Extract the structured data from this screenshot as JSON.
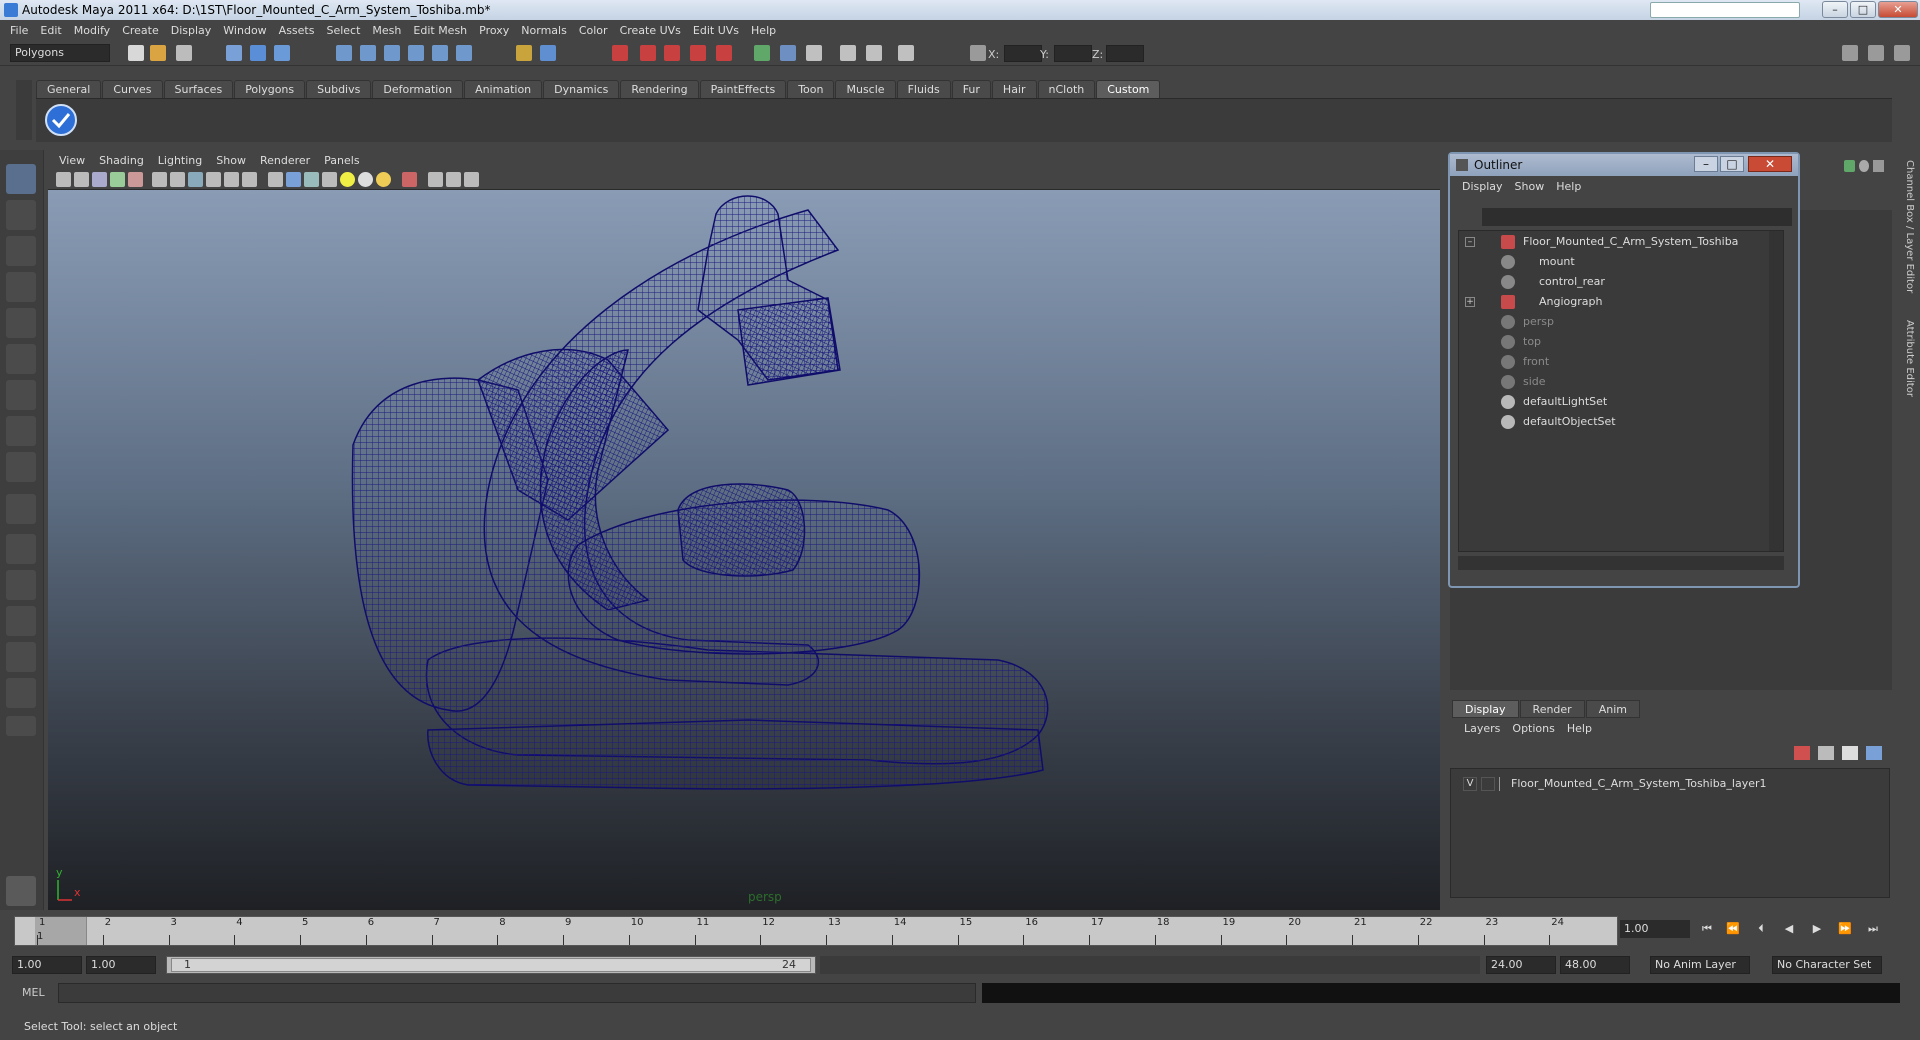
{
  "window": {
    "title": "Autodesk Maya 2011 x64: D:\\1ST\\Floor_Mounted_C_Arm_System_Toshiba.mb*"
  },
  "menubar": [
    "File",
    "Edit",
    "Modify",
    "Create",
    "Display",
    "Window",
    "Assets",
    "Select",
    "Mesh",
    "Edit Mesh",
    "Proxy",
    "Normals",
    "Color",
    "Create UVs",
    "Edit UVs",
    "Help"
  ],
  "statusline": {
    "mode": "Polygons",
    "x_label": "X:",
    "y_label": "Y:",
    "z_label": "Z:"
  },
  "shelf_tabs": [
    "General",
    "Curves",
    "Surfaces",
    "Polygons",
    "Subdivs",
    "Deformation",
    "Animation",
    "Dynamics",
    "Rendering",
    "PaintEffects",
    "Toon",
    "Muscle",
    "Fluids",
    "Fur",
    "Hair",
    "nCloth",
    "Custom"
  ],
  "shelf_active": "Custom",
  "viewport": {
    "menu": [
      "View",
      "Shading",
      "Lighting",
      "Show",
      "Renderer",
      "Panels"
    ],
    "camera": "persp",
    "axis_y": "y",
    "axis_x": "x"
  },
  "outliner": {
    "title": "Outliner",
    "menu": [
      "Display",
      "Show",
      "Help"
    ],
    "items": [
      {
        "label": "Floor_Mounted_C_Arm_System_Toshiba",
        "dim": false
      },
      {
        "label": "mount",
        "dim": false
      },
      {
        "label": "control_rear",
        "dim": false
      },
      {
        "label": "Angiograph",
        "dim": false
      },
      {
        "label": "persp",
        "dim": true
      },
      {
        "label": "top",
        "dim": true
      },
      {
        "label": "front",
        "dim": true
      },
      {
        "label": "side",
        "dim": true
      },
      {
        "label": "defaultLightSet",
        "dim": false
      },
      {
        "label": "defaultObjectSet",
        "dim": false
      }
    ]
  },
  "side_tabs": [
    "Channel Box / Layer Editor",
    "Attribute Editor"
  ],
  "layer_editor": {
    "tabs": [
      "Display",
      "Render",
      "Anim"
    ],
    "menu": [
      "Layers",
      "Options",
      "Help"
    ],
    "layer_visibility": "V",
    "layer_name": "Floor_Mounted_C_Arm_System_Toshiba_layer1"
  },
  "timeline": {
    "ticks": [
      "1",
      "2",
      "3",
      "4",
      "5",
      "6",
      "7",
      "8",
      "9",
      "10",
      "11",
      "12",
      "13",
      "14",
      "15",
      "16",
      "17",
      "18",
      "19",
      "20",
      "21",
      "22",
      "23",
      "24"
    ],
    "current_frame_marker": "1",
    "current_frame": "1.00"
  },
  "range": {
    "start": "1.00",
    "playback_start": "1.00",
    "slider_start": "1",
    "slider_end": "24",
    "playback_end": "24.00",
    "end": "48.00",
    "anim_layer": "No Anim Layer",
    "character_set": "No Character Set"
  },
  "command": {
    "label": "MEL"
  },
  "help_line": "Select Tool: select an object",
  "colors": {
    "wire": "#1c1880",
    "accent": "#7f96b3"
  }
}
